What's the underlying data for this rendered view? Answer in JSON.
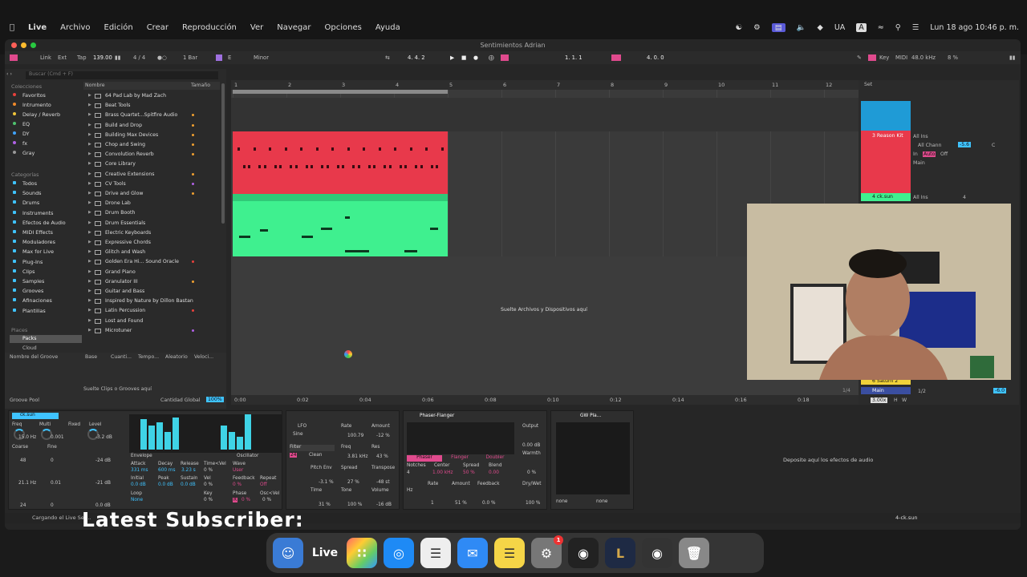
{
  "menubar": {
    "app": "Live",
    "menus": [
      "Archivo",
      "Edición",
      "Crear",
      "Reproducción",
      "Ver",
      "Navegar",
      "Opciones",
      "Ayuda"
    ],
    "input_lang": "UA",
    "keyboard": "A",
    "datetime": "Lun 18 ago 10:46 p. m."
  },
  "window": {
    "title": "Sentimientos  Adrian"
  },
  "transport": {
    "link": "Link",
    "ext": "Ext",
    "tap": "Tap",
    "tempo": "139.00",
    "signature": "4 / 4",
    "quantize": "1 Bar",
    "key": "E",
    "scale": "Minor",
    "position": "4.   4.   2",
    "loop_start": "1.   1.   1",
    "loop_len": "4.   0.   0",
    "key_label": "Key",
    "midi_label": "MIDI",
    "sample_rate": "48.0 kHz",
    "cpu": "8 %"
  },
  "browser": {
    "search_placeholder": "Buscar (Cmd + F)",
    "collections_title": "Colecciones",
    "collections": [
      {
        "label": "Favoritos",
        "color": "#e8413c"
      },
      {
        "label": "Intrumento",
        "color": "#f08a2b"
      },
      {
        "label": "Delay / Reverb",
        "color": "#f0c53a"
      },
      {
        "label": "EQ",
        "color": "#4fc26e"
      },
      {
        "label": "DY",
        "color": "#3fa3ff"
      },
      {
        "label": "fx",
        "color": "#b061e6"
      },
      {
        "label": "Gray",
        "color": "#999999"
      }
    ],
    "categories_title": "Categorías",
    "categories": [
      "Todos",
      "Sounds",
      "Drums",
      "Instruments",
      "Efectos de Audio",
      "MIDI Effects",
      "Moduladores",
      "Max for Live",
      "Plug-Ins",
      "Clips",
      "Samples",
      "Grooves",
      "Afinaciones",
      "Plantillas"
    ],
    "places_title": "Places",
    "places": [
      "Packs",
      "Cloud"
    ],
    "col_name": "Nombre",
    "col_size": "Tamaño",
    "packs": [
      {
        "label": "64 Pad Lab by Mad Zach",
        "tag": ""
      },
      {
        "label": "Beat Tools",
        "tag": ""
      },
      {
        "label": "Brass Quartet...Spitfire Audio",
        "tag": "#f0a030"
      },
      {
        "label": "Build and Drop",
        "tag": "#f0a030"
      },
      {
        "label": "Building Max Devices",
        "tag": "#f0a030"
      },
      {
        "label": "Chop and Swing",
        "tag": "#f0a030"
      },
      {
        "label": "Convolution Reverb",
        "tag": "#f0a030"
      },
      {
        "label": "Core Library",
        "tag": ""
      },
      {
        "label": "Creative Extensions",
        "tag": "#f0a030"
      },
      {
        "label": "CV Tools",
        "tag": "#b061e6"
      },
      {
        "label": "Drive and Glow",
        "tag": "#f0a030"
      },
      {
        "label": "Drone Lab",
        "tag": ""
      },
      {
        "label": "Drum Booth",
        "tag": ""
      },
      {
        "label": "Drum Essentials",
        "tag": ""
      },
      {
        "label": "Electric Keyboards",
        "tag": ""
      },
      {
        "label": "Expressive Chords",
        "tag": ""
      },
      {
        "label": "Glitch and Wash",
        "tag": ""
      },
      {
        "label": "Golden Era Hi... Sound Oracle",
        "tag": "#e8413c"
      },
      {
        "label": "Grand Piano",
        "tag": ""
      },
      {
        "label": "Granulator III",
        "tag": "#f0a030"
      },
      {
        "label": "Guitar and Bass",
        "tag": ""
      },
      {
        "label": "Inspired by Nature by Dillon Bastan",
        "tag": ""
      },
      {
        "label": "Latin Percussion",
        "tag": "#e8413c"
      },
      {
        "label": "Lost and Found",
        "tag": ""
      },
      {
        "label": "Microtuner",
        "tag": "#b061e6"
      }
    ],
    "groove_cols": [
      "Nombre del Groove",
      "Base",
      "Cuanti...",
      "Tempo...",
      "Aleatorio",
      "Veloci..."
    ],
    "groove_drop": "Suelte Clips o Grooves aquí",
    "groove_pool": "Groove Pool",
    "global_amount_label": "Cantidad Global",
    "global_amount": "100%"
  },
  "arrangement": {
    "bars": [
      "1",
      "2",
      "3",
      "4",
      "5",
      "6",
      "7",
      "8",
      "9",
      "10",
      "11",
      "12"
    ],
    "times": [
      "0:00",
      "0:02",
      "0:04",
      "0:06",
      "0:08",
      "0:10",
      "0:12",
      "0:14",
      "0:16",
      "0:18"
    ],
    "drop_hint": "Suelte Archivos y Dispositivos aquí",
    "zoom": "1/4"
  },
  "mixer": {
    "set_label": "Set",
    "tracks": [
      {
        "name": "3 Reason Kit",
        "input": "All Ins",
        "channel": "All Chann",
        "monitor_in": "In",
        "monitor_auto": "Auto",
        "monitor_off": "Off",
        "output": "Main",
        "vol": "-5.6",
        "pan": "C",
        "color": "#e8394b"
      },
      {
        "name": "4 ck.sun",
        "input": "All Ins",
        "vol": "4",
        "color": "#3ff08f"
      }
    ],
    "bottom_tracks": [
      "6 Saturn 2",
      "Main"
    ],
    "master_ratio": "1/2",
    "master_vol": "-6.0",
    "tempo_small": "3.00x",
    "h": "H",
    "w": "W"
  },
  "devices": {
    "track_name": "ck.sun",
    "synth": {
      "freq1": "15.0 Hz",
      "multi1": "0.001",
      "level1": "-3.2 dB",
      "coarse1": "48",
      "fine1": "0",
      "level2": "-24 dB",
      "freq2": "21.1 Hz",
      "multi2": "0.01",
      "level3": "-21 dB",
      "coarse2": "24",
      "fine2": "0",
      "level4": "0.0 dB",
      "envelope": "Envelope",
      "oscillator": "Oscillator",
      "attack": "331 ms",
      "decay": "600 ms",
      "release": "3.23 s",
      "time_vel": "0 %",
      "wave": "User",
      "initial": "0.0 dB",
      "peak": "0.0 dB",
      "sustain": "0.0 dB",
      "vel": "0 %",
      "feedback": "0 %",
      "repeat": "Off",
      "loop": "None",
      "key": "0 %",
      "phase_r": "R",
      "phase_val": "0 %",
      "osc_vel": "0 %"
    },
    "lfo": {
      "title": "LFO",
      "shape": "Sine",
      "rate": "100.79",
      "amount": "-12 %",
      "filter": "Filter",
      "filter_slope": "24",
      "filter_type": "Clean",
      "freq": "3.81 kHz",
      "res": "43 %",
      "pitch_env": "-3.1 %",
      "spread": "27 %",
      "transpose": "-48 st",
      "time": "31 %",
      "tone": "100 %",
      "volume": "-16 dB"
    },
    "phaser": {
      "title": "Phaser-Flanger",
      "modes": [
        "Phaser",
        "Flanger",
        "Doubler"
      ],
      "notches": "4",
      "center": "1.00 kHz",
      "spread": "50 %",
      "blend": "0.00",
      "output": "0.00 dB",
      "warmth": "0 %",
      "rate": "1",
      "amount": "51 %",
      "feedback": "0.0 %",
      "dry_wet": "100 %",
      "mode_hz": "Hz"
    },
    "gw": {
      "title": "GW Pla...",
      "sel1": "none",
      "sel2": "none"
    },
    "drop_hint": "Deposite aquí los efectos de audio"
  },
  "bottom": {
    "status": "Cargando el Live Set...",
    "clip_name": "4-ck.sun"
  },
  "overlay": {
    "subscriber": "Latest Subscriber:"
  },
  "dock": {
    "live": "Live",
    "badge": "1"
  }
}
